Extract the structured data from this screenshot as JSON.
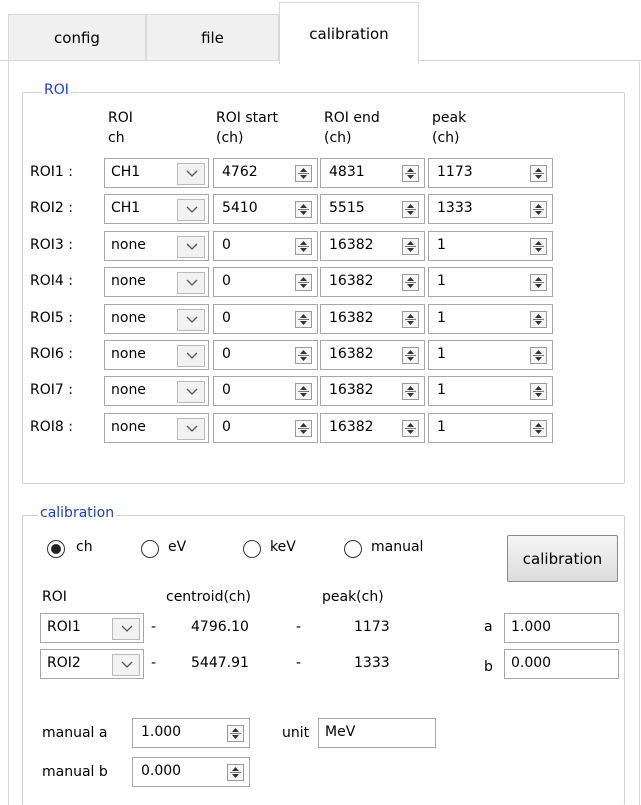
{
  "tabs": [
    {
      "label": "config"
    },
    {
      "label": "file"
    },
    {
      "label": "calibration"
    }
  ],
  "roi_group": {
    "title": "ROI",
    "headers": {
      "ch_1": "ROI",
      "ch_2": "ch",
      "start_1": "ROI start",
      "start_2": "(ch)",
      "end_1": "ROI end",
      "end_2": "(ch)",
      "peak_1": "peak",
      "peak_2": "(ch)"
    },
    "rows": [
      {
        "label": "ROI1 :",
        "ch": "CH1",
        "start": "4762",
        "end": "4831",
        "peak": "1173"
      },
      {
        "label": "ROI2 :",
        "ch": "CH1",
        "start": "5410",
        "end": "5515",
        "peak": "1333"
      },
      {
        "label": "ROI3 :",
        "ch": "none",
        "start": "0",
        "end": "16382",
        "peak": "1"
      },
      {
        "label": "ROI4 :",
        "ch": "none",
        "start": "0",
        "end": "16382",
        "peak": "1"
      },
      {
        "label": "ROI5 :",
        "ch": "none",
        "start": "0",
        "end": "16382",
        "peak": "1"
      },
      {
        "label": "ROI6 :",
        "ch": "none",
        "start": "0",
        "end": "16382",
        "peak": "1"
      },
      {
        "label": "ROI7 :",
        "ch": "none",
        "start": "0",
        "end": "16382",
        "peak": "1"
      },
      {
        "label": "ROI8 :",
        "ch": "none",
        "start": "0",
        "end": "16382",
        "peak": "1"
      }
    ]
  },
  "calibration_group": {
    "title": "calibration",
    "radios": [
      {
        "label": "ch",
        "checked": true
      },
      {
        "label": "eV",
        "checked": false
      },
      {
        "label": "keV",
        "checked": false
      },
      {
        "label": "manual",
        "checked": false
      }
    ],
    "button_label": "calibration",
    "headers": {
      "roi": "ROI",
      "centroid": "centroid(ch)",
      "peak": "peak(ch)"
    },
    "rows": [
      {
        "roi": "ROI1",
        "dash1": "-",
        "centroid": "4796.10",
        "dash2": "-",
        "peak": "1173",
        "coef_label": "a",
        "coef_value": "1.000"
      },
      {
        "roi": "ROI2",
        "dash1": "-",
        "centroid": "5447.91",
        "dash2": "-",
        "peak": "1333",
        "coef_label": "b",
        "coef_value": "0.000"
      }
    ],
    "manual_a_label": "manual a",
    "manual_a_value": "1.000",
    "manual_b_label": "manual b",
    "manual_b_value": "0.000",
    "unit_label": "unit",
    "unit_value": "MeV"
  }
}
